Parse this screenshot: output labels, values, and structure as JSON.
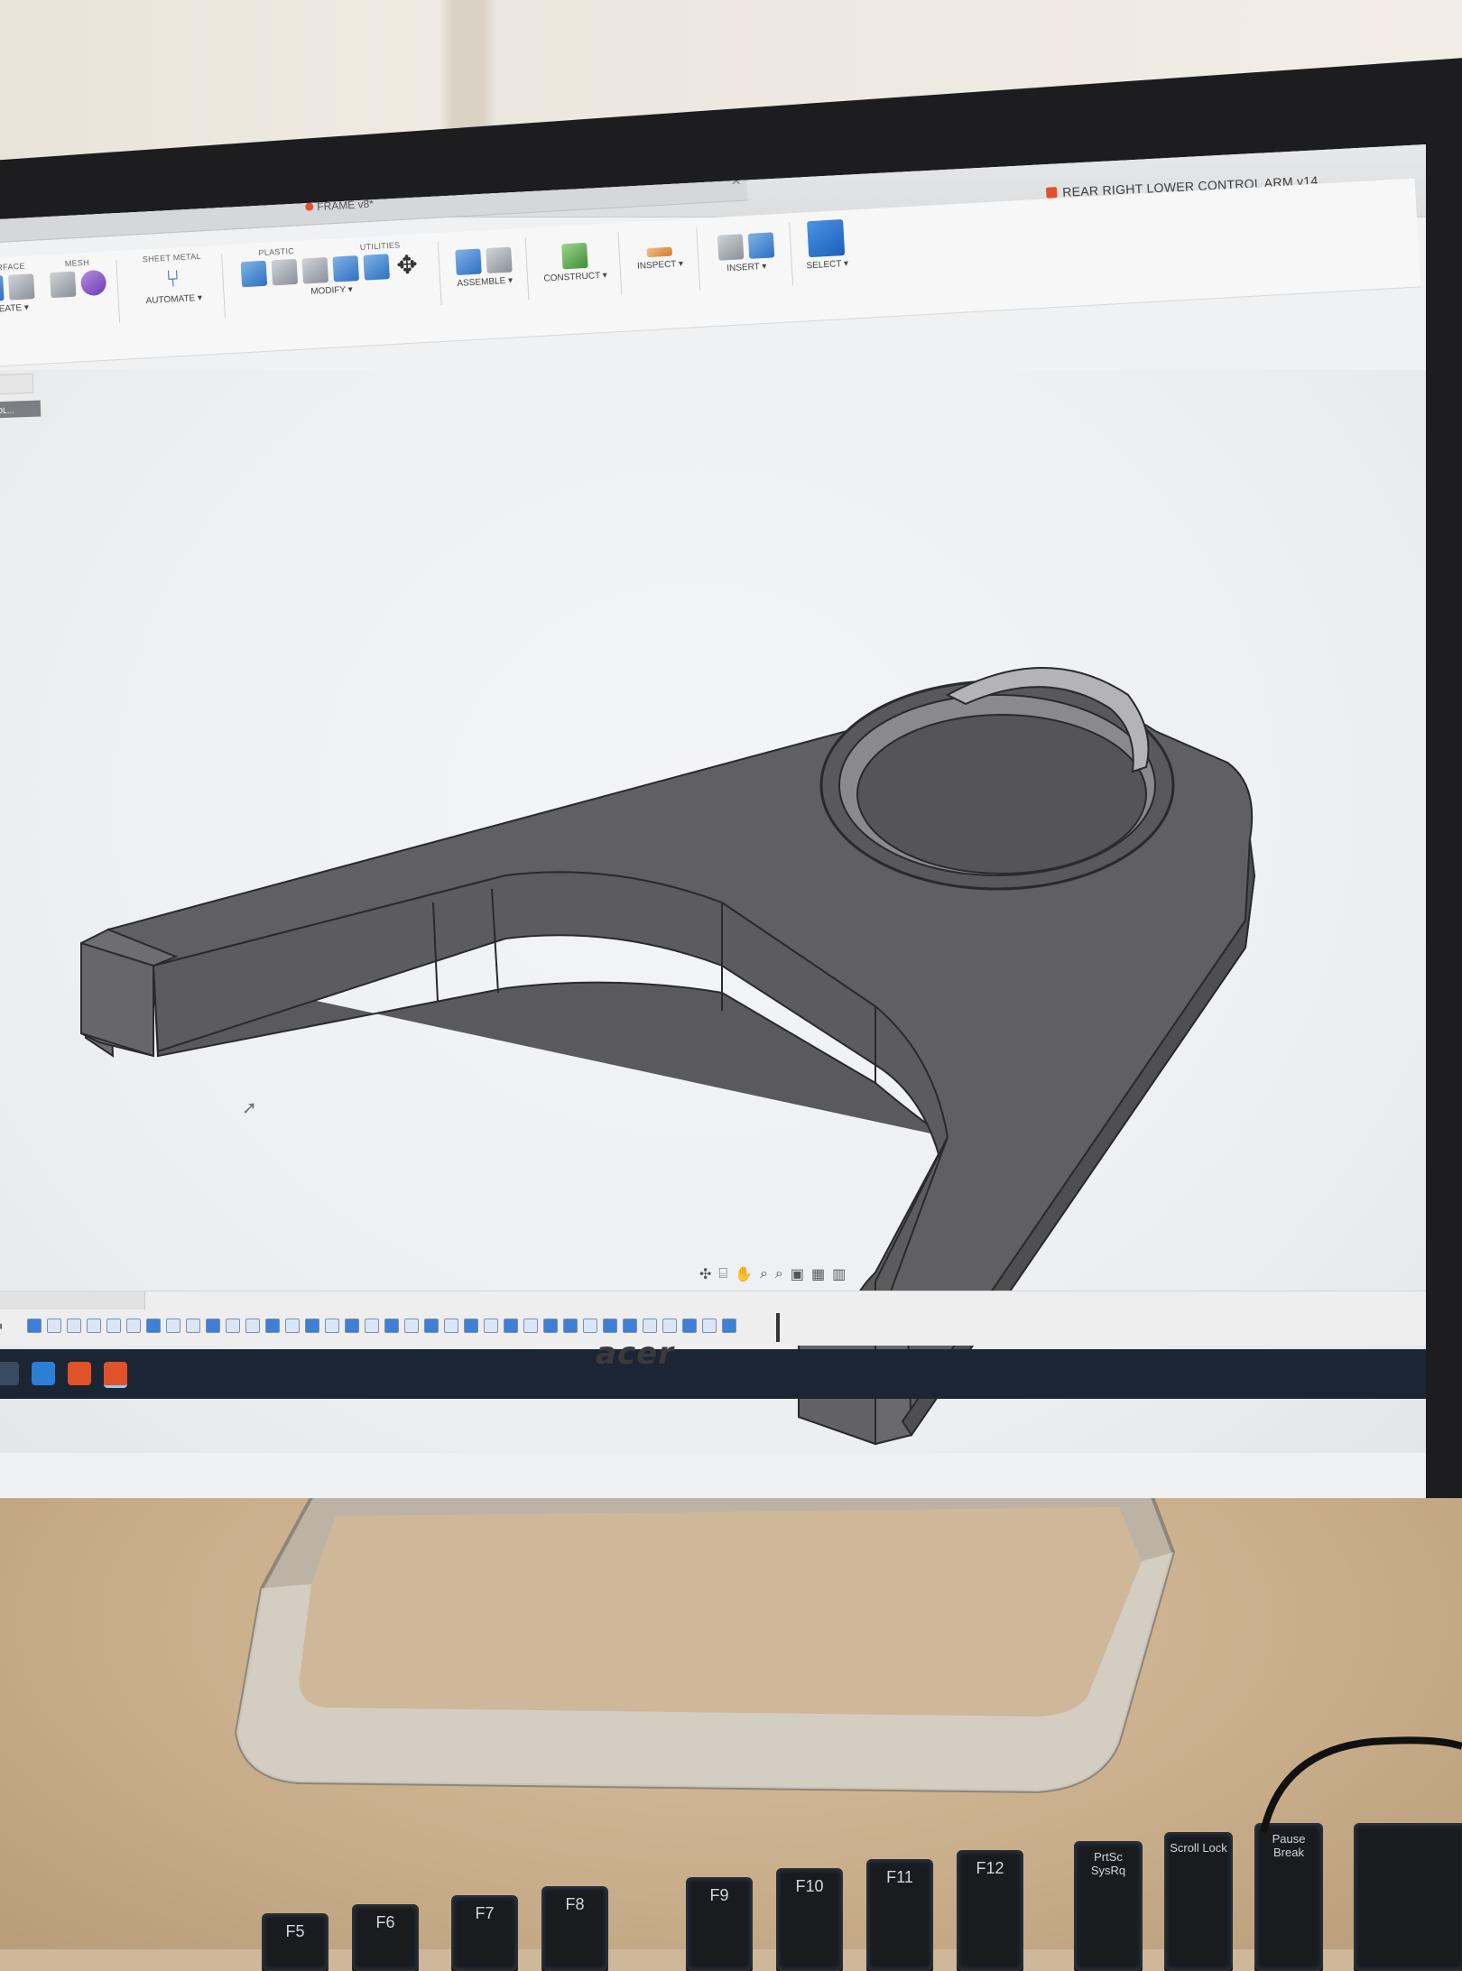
{
  "app": {
    "document_title": "REAR RIGHT LOWER CONTROL ARM v14",
    "tab_title": "FRAME v8*"
  },
  "toolbar": {
    "categories": [
      "SURFACE",
      "MESH",
      "SHEET METAL",
      "PLASTIC",
      "UTILITIES"
    ],
    "groups": [
      "CREATE",
      "AUTOMATE",
      "MODIFY",
      "ASSEMBLE",
      "CONSTRUCT",
      "INSPECT",
      "INSERT",
      "SELECT"
    ]
  },
  "browser": {
    "component_label": "CONTROL..."
  },
  "bezel": {
    "brand": "acer"
  },
  "keyboard": {
    "keys": [
      "F5",
      "F6",
      "F7",
      "F8",
      "F9",
      "F10",
      "F11",
      "F12",
      "PrtSc SysRq",
      "Scroll Lock",
      "Pause Break"
    ]
  },
  "colors": {
    "accent_orange": "#e0522a",
    "toolbar_blue": "#2f6fbf",
    "model_grey": "#5f5f60",
    "taskbar": "#1c2533"
  }
}
